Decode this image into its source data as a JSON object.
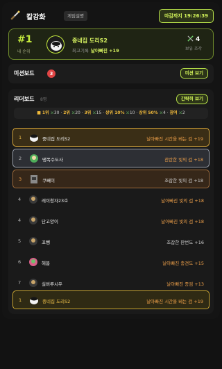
{
  "header": {
    "title": "칼강화",
    "desc_label": "게임설명",
    "timer": "마감까지 19:26:39"
  },
  "my": {
    "rank": "#1",
    "rank_label": "내 순위",
    "name": "중네집 도리S2",
    "best_label": "최고기록",
    "best_value": "날아빠진 +19",
    "pieces": "4",
    "pieces_label": "보유 조각"
  },
  "mission": {
    "title": "미션보드",
    "badge": "3",
    "button": "미션 보기"
  },
  "board": {
    "title": "리더보드",
    "count": "8명",
    "button": "간략히 보기",
    "rewards": [
      {
        "rank": "1위",
        "count": "30"
      },
      {
        "rank": "2위",
        "count": "20"
      },
      {
        "rank": "3위",
        "count": "15"
      },
      {
        "rank": "상위 10%",
        "count": "10"
      },
      {
        "rank": "상위 50%",
        "count": "4"
      },
      {
        "rank": "참여",
        "count": "2"
      }
    ],
    "rows": [
      {
        "pos": "1",
        "name": "중네집 도리S2",
        "sword": "날아빠진 시간을 베는 검 +19",
        "style": "top1",
        "tone": "orange"
      },
      {
        "pos": "2",
        "name": "땡폭수도사",
        "sword": "찬란한 빛의 검 +18",
        "style": "top2",
        "tone": "orange"
      },
      {
        "pos": "3",
        "name": "쿠빼이",
        "sword": "조잡한 빛의 검 +18",
        "style": "top3",
        "tone": "plain"
      },
      {
        "pos": "4",
        "name": "레이청자23호",
        "sword": "날아빠진 빛의 검 +18",
        "style": "",
        "tone": "orange"
      },
      {
        "pos": "4",
        "name": "단고양이",
        "sword": "날아빠진 빛의 검 +18",
        "style": "",
        "tone": "orange"
      },
      {
        "pos": "5",
        "name": "꼬뺑",
        "sword": "조잡한 판번도 +16",
        "style": "",
        "tone": "plain"
      },
      {
        "pos": "6",
        "name": "해봄",
        "sword": "날아빠진 충견도 +15",
        "style": "",
        "tone": "orange"
      },
      {
        "pos": "7",
        "name": "실버루시우",
        "sword": "날아빠진 종검 +13",
        "style": "",
        "tone": "orange"
      },
      {
        "pos": "1",
        "name": "중네집 도리S2",
        "sword": "날아빠진 시간을 베는 검 +19",
        "style": "me",
        "tone": "orange"
      }
    ]
  },
  "colors": {
    "accent": "#c6ec3e",
    "gold": "#d7a63a",
    "silver": "#9aa0aa",
    "bronze": "#9d6a3a",
    "badge_red": "#e04545"
  },
  "icons": {
    "logo": "sword-wand-icon",
    "piece": "sword-piece-icon",
    "reward": "gift-icon"
  }
}
